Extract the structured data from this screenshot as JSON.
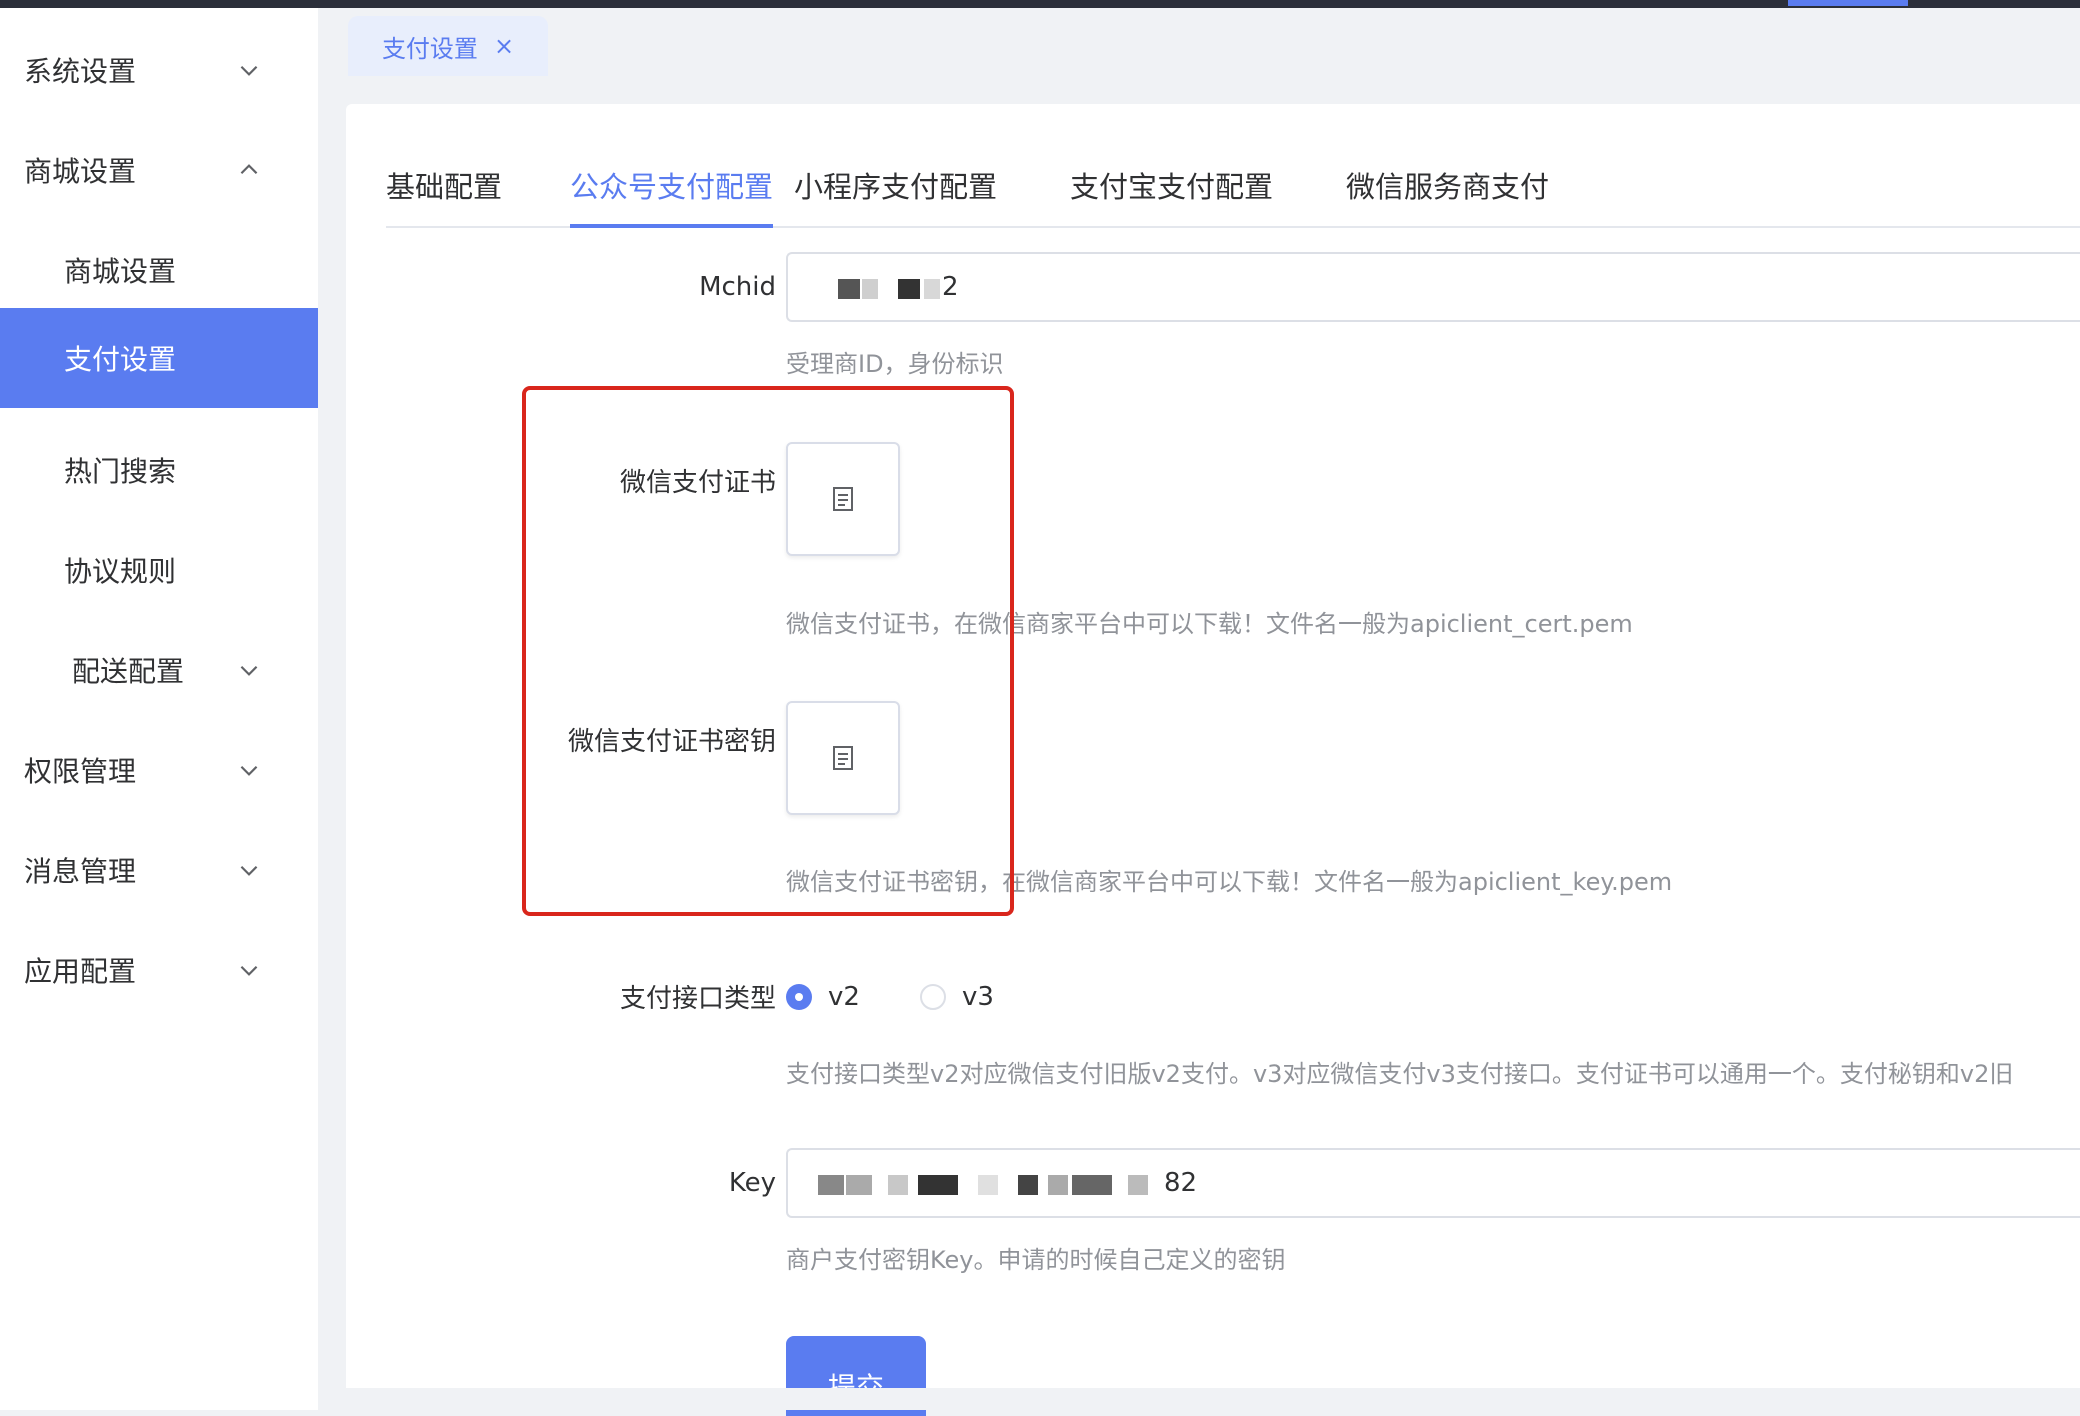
{
  "sidebar": {
    "items": [
      {
        "label": "系统设置",
        "expanded": false
      },
      {
        "label": "商城设置",
        "expanded": true
      },
      {
        "label": "商城设置"
      },
      {
        "label": "支付设置",
        "active": true
      },
      {
        "label": "热门搜索"
      },
      {
        "label": "协议规则"
      },
      {
        "label": "配送配置",
        "expanded": false
      },
      {
        "label": "权限管理",
        "expanded": false
      },
      {
        "label": "消息管理",
        "expanded": false
      },
      {
        "label": "应用配置",
        "expanded": false
      }
    ]
  },
  "page_tab": {
    "label": "支付设置",
    "close": "×"
  },
  "tabs": [
    {
      "label": "基础配置"
    },
    {
      "label": "公众号支付配置",
      "active": true
    },
    {
      "label": "小程序支付配置"
    },
    {
      "label": "支付宝支付配置"
    },
    {
      "label": "微信服务商支付"
    }
  ],
  "form": {
    "mchid": {
      "label": "Mchid",
      "value": "2",
      "help": "受理商ID，身份标识"
    },
    "cert": {
      "label": "微信支付证书",
      "help": "微信支付证书，在微信商家平台中可以下载！文件名一般为apiclient_cert.pem"
    },
    "cert_key": {
      "label": "微信支付证书密钥",
      "help": "微信支付证书密钥，在微信商家平台中可以下载！文件名一般为apiclient_key.pem"
    },
    "api_type": {
      "label": "支付接口类型",
      "options": [
        "v2",
        "v3"
      ],
      "selected": "v2",
      "help": "支付接口类型v2对应微信支付旧版v2支付。v3对应微信支付v3支付接口。支付证书可以通用一个。支付秘钥和v2旧"
    },
    "key": {
      "label": "Key",
      "value": "82",
      "help": "商户支付密钥Key。申请的时候自己定义的密钥"
    },
    "submit_label": "提交"
  },
  "colors": {
    "accent": "#5a7cf0",
    "highlight": "#d9261c",
    "muted_text": "#909399"
  },
  "icons": {
    "chevron": "chevron-icon",
    "file": "document-icon"
  }
}
